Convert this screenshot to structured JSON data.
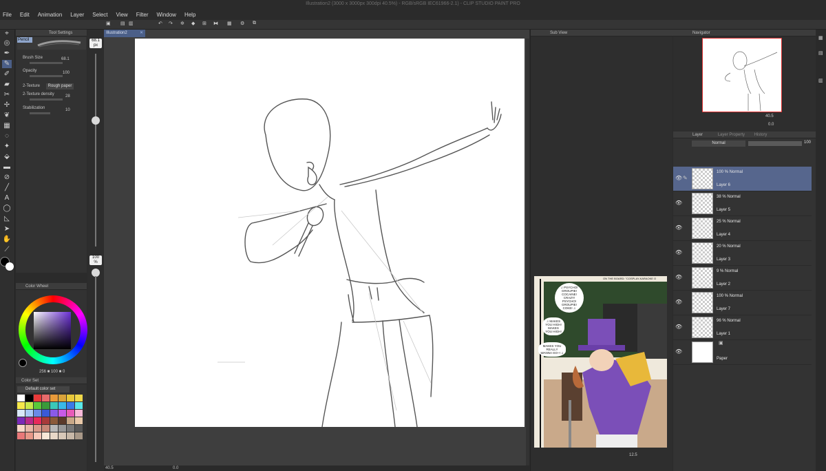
{
  "window": {
    "title": "Illustration2 (3000 x 3000px 300dpi 40.5%)  - RGB/sRGB IEC61966-2.1) - CLIP STUDIO PAINT PRO"
  },
  "menu": [
    "File",
    "Edit",
    "Animation",
    "Layer",
    "Select",
    "View",
    "Filter",
    "Window",
    "Help"
  ],
  "tool_settings": {
    "header": "Tool Settings",
    "brush_name": "Pencil",
    "brush_size_label": "Brush Size",
    "brush_size_value": "68.1",
    "opacity_label": "Opacity",
    "opacity_value": "100",
    "texture_label": "2-Texture",
    "texture_value": "Rough paper",
    "texture_density_label": "2-Texture density",
    "texture_density_value": "28",
    "stabilization_label": "Stabilization",
    "stabilization_value": "10"
  },
  "brush_size_strip": {
    "size_value": "68.1",
    "size_unit": "px",
    "opacity_value": "100",
    "opacity_unit": "%"
  },
  "color_wheel": {
    "header": "Color Wheel",
    "readout": "256 ■ 100 ■ 0"
  },
  "color_set": {
    "header": "Color Set",
    "set_name": "Default color set"
  },
  "document": {
    "tab": "Illustration2",
    "zoom": "40.5",
    "angle": "0.0"
  },
  "subview": {
    "header": "Sub View",
    "zoom": "12.5"
  },
  "reference": {
    "caption": "ON THE BOARD: \"COSPLAY-KARAOKE O",
    "bubble1": "♫ PSYCHO! GROUPIE! COCAINE! CRAZY! PSYCHO! GROUPIE! COKE! ♫",
    "bubble2": "♫ MAKES YOU HIGH! MAKES YOU HIGH!",
    "bubble3": "MAKES YOU REALLY WANNA GO~! ♫"
  },
  "navigator": {
    "header": "Navigator",
    "zoom": "40.5",
    "angle": "0.0"
  },
  "layer_panel": {
    "tabs": [
      "Layer",
      "Layer Property",
      "History"
    ],
    "blend_mode": "Normal",
    "opacity": "100",
    "layers": [
      {
        "prop": "100 % Normal",
        "name": "Layer 6",
        "selected": true
      },
      {
        "prop": "38 % Normal",
        "name": "Layer 5",
        "selected": false
      },
      {
        "prop": "25 % Normal",
        "name": "Layer 4",
        "selected": false
      },
      {
        "prop": "20 % Normal",
        "name": "Layer 3",
        "selected": false
      },
      {
        "prop": "9 % Normal",
        "name": "Layer 2",
        "selected": false
      },
      {
        "prop": "100 % Normal",
        "name": "Layer 7",
        "selected": false
      },
      {
        "prop": "96 % Normal",
        "name": "Layer 1",
        "selected": false
      },
      {
        "prop": "",
        "name": "Paper",
        "selected": false
      }
    ]
  },
  "colors": {
    "accent": "#4b5f88",
    "selected_layer": "#56668d",
    "panel_bg": "#323232",
    "purple_hat": "#7b4fb8"
  }
}
